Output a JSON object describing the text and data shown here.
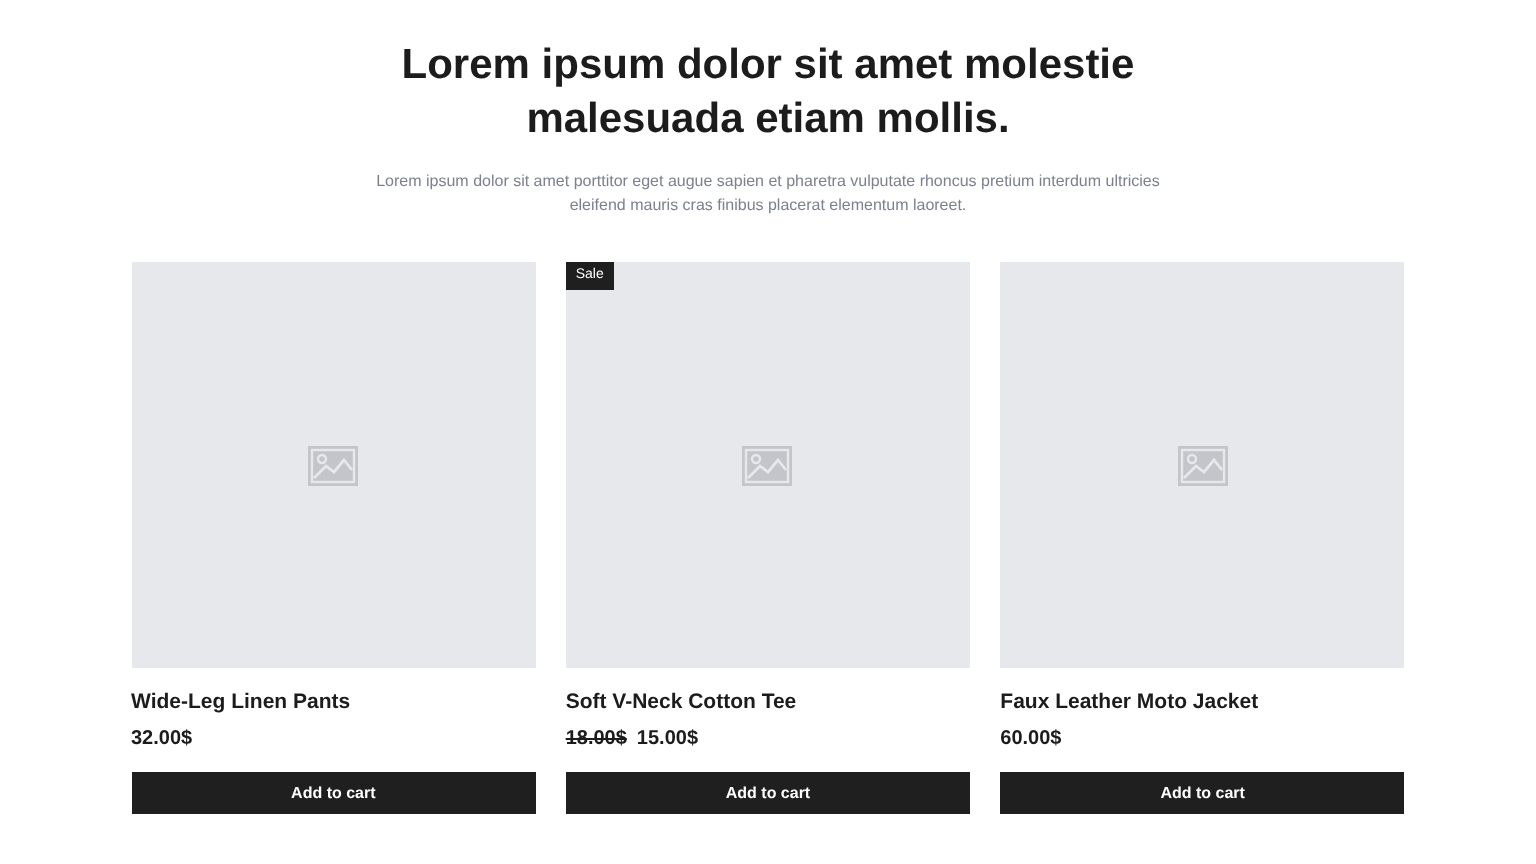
{
  "heading": "Lorem ipsum dolor sit amet molestie malesuada etiam mollis.",
  "subheading": "Lorem ipsum dolor sit amet porttitor eget augue sapien et pharetra vulputate rhoncus pretium interdum ultricies eleifend mauris cras finibus placerat elementum laoreet.",
  "products": [
    {
      "name": "Wide-Leg Linen Pants",
      "price": "32.00$",
      "button": "Add to cart"
    },
    {
      "name": "Soft V-Neck Cotton Tee",
      "badge": "Sale",
      "old_price": "18.00$",
      "price": "15.00$",
      "button": "Add to cart"
    },
    {
      "name": "Faux Leather Moto Jacket",
      "price": "60.00$",
      "button": "Add to cart"
    }
  ]
}
